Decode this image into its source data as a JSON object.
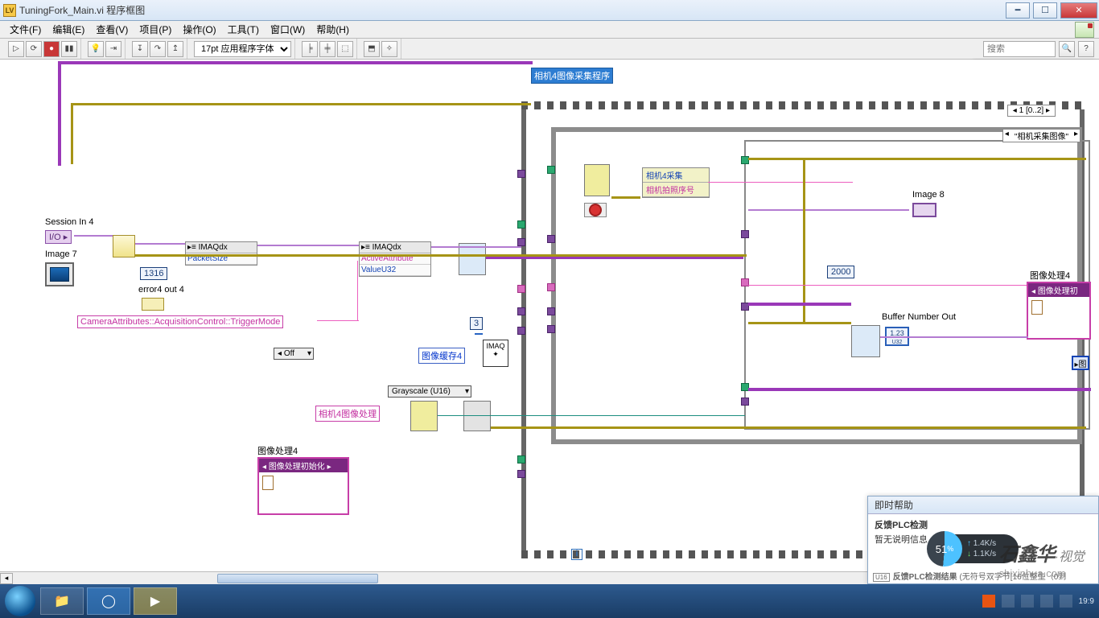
{
  "window": {
    "title": "TuningFork_Main.vi 程序框图"
  },
  "menu": {
    "file": "文件(F)",
    "edit": "编辑(E)",
    "view": "查看(V)",
    "project": "项目(P)",
    "operate": "操作(O)",
    "tools": "工具(T)",
    "window": "窗口(W)",
    "help": "帮助(H)"
  },
  "toolbar": {
    "font": "17pt 应用程序字体",
    "search_ph": "搜索"
  },
  "canvas": {
    "banner": "相机4图像采集程序",
    "session_in": "Session In 4",
    "image7": "Image 7",
    "image8": "Image 8",
    "error4": "error4 out 4",
    "packet_const": "1316",
    "imaqdx": "IMAQdx",
    "packet_size": "PacketSize",
    "active_attr": "ActiveAttribute",
    "valueu32": "ValueU32",
    "cam_attr": "CameraAttributes::AcquisitionControl::TriggerMode",
    "off": "Off",
    "three": "3",
    "img_buf4": "图像缓存4",
    "grayscale": "Grayscale (U16)",
    "imaq": "IMAQ",
    "cam4_proc": "相机4图像处理",
    "img_proc4": "图像处理4",
    "img_proc_init": "图像处理初始化",
    "cam4_acq": "相机4采集",
    "cam_shot_seq": "相机拍照序号",
    "const2000": "2000",
    "buf_num_out": "Buffer Number Out",
    "proc_label": "图像处理4",
    "proc_init_row": "图像处理初",
    "case_selector": "1 [0..2]",
    "inner_case": "\"相机采集图像\"",
    "info_i": "i"
  },
  "context_help": {
    "title": "即时帮助",
    "l1": "反馈PLC检测",
    "l2": "暂无说明信息",
    "l3_pre": "反馈PLC检测结果",
    "l3_suf": "(无符号双字节[16位整型（0到"
  },
  "speed": {
    "pct": "51",
    "pct_suf": "%",
    "up": "1.4K/s",
    "dn": "1.1K/s"
  },
  "taskbar": {
    "time": "19:9"
  },
  "watermark": {
    "script": "石鑫华",
    "plain": "·视觉",
    "domain": "shixinhua.com"
  }
}
